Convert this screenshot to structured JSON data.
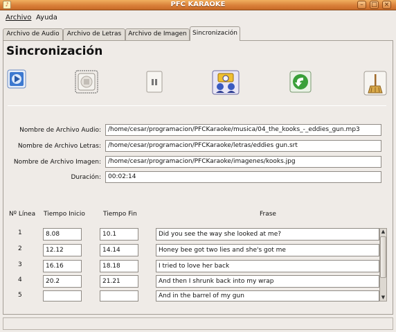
{
  "window": {
    "title": "PFC KARAOKE"
  },
  "menu": {
    "archivo": "Archivo",
    "ayuda": "Ayuda"
  },
  "tabs": [
    "Archivo de Audio",
    "Archivo de Letras",
    "Archivo de Imagen",
    "Sincronización"
  ],
  "active_tab": "Sincronización",
  "page_title": "Sincronización",
  "toolbar": {
    "icons": [
      "play-icon",
      "stop-icon",
      "pause-icon",
      "sync-people-icon",
      "back-arrow-icon",
      "broom-icon"
    ]
  },
  "form": {
    "audio_label": "Nombre de Archivo Audio:",
    "audio_value": "/home/cesar/programacion/PFCKaraoke/musica/04_the_kooks_-_eddies_gun.mp3",
    "letras_label": "Nombre de Archivo Letras:",
    "letras_value": "/home/cesar/programacion/PFCKaraoke/letras/eddies gun.srt",
    "imagen_label": "Nombre de Archivo Imagen:",
    "imagen_value": "/home/cesar/programacion/PFCKaraoke/imagenes/kooks.jpg",
    "duracion_label": "Duración:",
    "duracion_value": "00:02:14"
  },
  "table": {
    "headers": {
      "linea": "Nº Línea",
      "inicio": "Tiempo Inicio",
      "fin": "Tiempo Fin",
      "frase": "Frase"
    },
    "rows": [
      {
        "n": "1",
        "inicio": "8.08",
        "fin": "10.1",
        "frase": "Did you see the way she looked at me?"
      },
      {
        "n": "2",
        "inicio": "12.12",
        "fin": "14.14",
        "frase": "Honey bee got two lies and she's got me"
      },
      {
        "n": "3",
        "inicio": "16.16",
        "fin": "18.18",
        "frase": "I tried to love her back"
      },
      {
        "n": "4",
        "inicio": "20.2",
        "fin": "21.21",
        "frase": "And then I shrunk back into my wrap"
      },
      {
        "n": "5",
        "inicio": "",
        "fin": "",
        "frase": "And in the barrel of my gun"
      }
    ]
  },
  "colors": {
    "titlebar": "#d9803a",
    "background": "#efebe7"
  }
}
